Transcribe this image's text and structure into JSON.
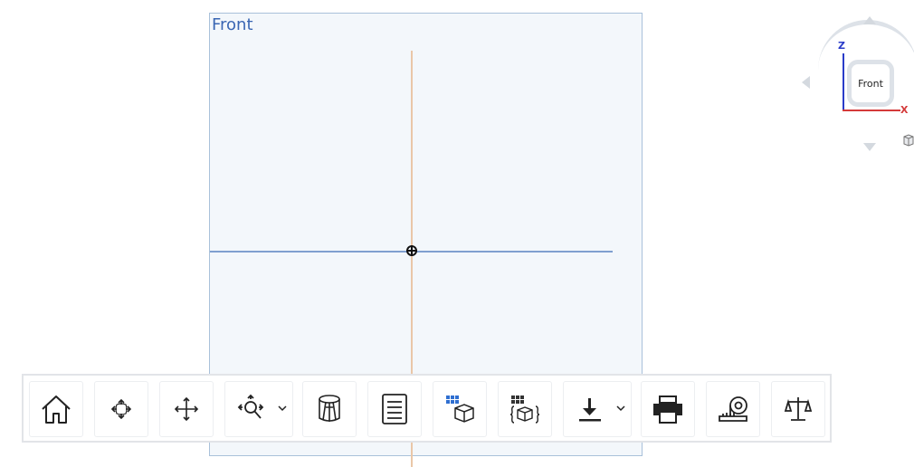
{
  "viewport": {
    "plane_label": "Front"
  },
  "viewcube": {
    "face_label": "Front",
    "axis_z": "Z",
    "axis_x": "X",
    "colors": {
      "z_axis": "#2a3cc9",
      "x_axis": "#d43a3a"
    }
  },
  "toolbar": {
    "buttons": [
      {
        "name": "home-view",
        "icon": "home-icon"
      },
      {
        "name": "zoom-to-fit",
        "icon": "fit-arrows-icon"
      },
      {
        "name": "pan",
        "icon": "move-arrows-icon"
      },
      {
        "name": "zoom",
        "icon": "zoom-magnifier-icon",
        "has_dropdown": true
      },
      {
        "name": "section-view",
        "icon": "section-cut-icon"
      },
      {
        "name": "properties",
        "icon": "document-lines-icon"
      },
      {
        "name": "configurations",
        "icon": "table-box-icon"
      },
      {
        "name": "variables",
        "icon": "variable-box-icon"
      },
      {
        "name": "export",
        "icon": "download-icon",
        "has_dropdown": true
      },
      {
        "name": "print",
        "icon": "printer-icon"
      },
      {
        "name": "measure",
        "icon": "tape-measure-icon"
      },
      {
        "name": "mass-properties",
        "icon": "balance-scale-icon"
      }
    ]
  }
}
